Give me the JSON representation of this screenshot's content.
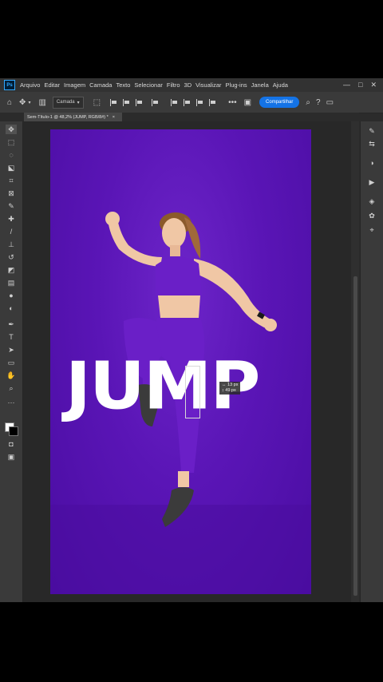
{
  "app": {
    "logo": "Ps",
    "menu": [
      "Arquivo",
      "Editar",
      "Imagem",
      "Camada",
      "Texto",
      "Selecionar",
      "Filtro",
      "3D",
      "Visualizar",
      "Plug-ins",
      "Janela",
      "Ajuda"
    ],
    "window_controls": [
      "—",
      "□",
      "✕"
    ]
  },
  "options_bar": {
    "home_icon": "home-icon",
    "move_icon": "move-icon",
    "auto_select_value": "Camada",
    "share_label": "Compartilhar",
    "right_icons": [
      "search-icon",
      "help-icon",
      "workspace-icon",
      "share-icon"
    ]
  },
  "document": {
    "tab_title": "Sem-Título-1 @ 48,2% (JUMP, RGB/8#) *",
    "close": "×"
  },
  "canvas": {
    "background_color": "#5a15b6",
    "text_layer": "JUMP",
    "hud_line1": "↔ 13 px",
    "hud_line2": "↕ 49 px"
  },
  "tools": [
    "move-tool",
    "marquee-tool",
    "lasso-tool",
    "object-select-tool",
    "crop-tool",
    "frame-tool",
    "eyedropper-tool",
    "healing-brush-tool",
    "brush-tool",
    "clone-stamp-tool",
    "history-brush-tool",
    "eraser-tool",
    "gradient-tool",
    "blur-tool",
    "dodge-tool",
    "pen-tool",
    "type-tool",
    "path-select-tool",
    "rectangle-tool",
    "hand-tool",
    "zoom-tool",
    "more-tools"
  ],
  "colors": {
    "foreground": "#ffffff",
    "background": "#000000"
  },
  "right_panel_icons": [
    "brush-settings-icon",
    "adjust-icon",
    "color-icon",
    "play-icon",
    "layers-icon",
    "channels-icon",
    "paths-icon"
  ]
}
